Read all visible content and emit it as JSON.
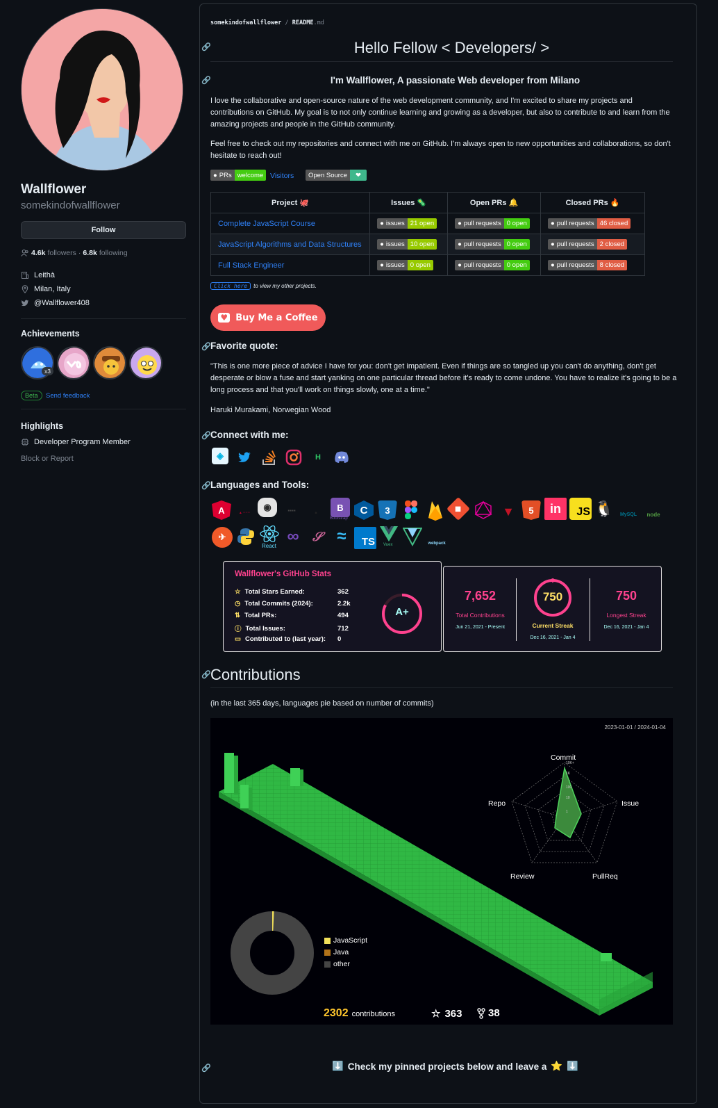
{
  "profile": {
    "name": "Wallflower",
    "login": "somekindofwallflower",
    "follow_label": "Follow",
    "followers_count": "4.6k",
    "followers_label": "followers",
    "separator": "·",
    "following_count": "6.8k",
    "following_label": "following",
    "company": "Leithà",
    "location": "Milan, Italy",
    "twitter": "@Wallflower408",
    "achievements_title": "Achievements",
    "achievement_multiplier": "x3",
    "beta_label": "Beta",
    "send_feedback": "Send feedback",
    "highlights_title": "Highlights",
    "highlight_item": "Developer Program Member",
    "block_report": "Block or Report"
  },
  "readme": {
    "breadcrumb_user": "somekindofwallflower",
    "breadcrumb_sep": "/",
    "breadcrumb_file": "README",
    "breadcrumb_ext": ".md",
    "title": "Hello Fellow < Developers/ >",
    "subtitle": "I'm Wallflower, A passionate Web developer from Milano",
    "para1": "I love the collaborative and open-source nature of the web development community, and I'm excited to share my projects and contributions on GitHub. My goal is to not only continue learning and growing as a developer, but also to contribute to and learn from the amazing projects and people in the GitHub community.",
    "para2": "Feel free to check out my repositories and connect with me on GitHub. I'm always open to new opportunities and collaborations, so don't hesitate to reach out!",
    "badge_prs_left": "PRs",
    "badge_prs_right": "welcome",
    "badge_visitors": "Visitors",
    "badge_open_source": "Open Source",
    "badge_heart": "❤",
    "table_headers": [
      "Project 🐙",
      "Issues 🦠",
      "Open PRs 🔔",
      "Closed PRs 🔥"
    ],
    "projects": [
      {
        "name": "Complete JavaScript Course",
        "issues": "21 open",
        "open_prs": "0 open",
        "closed_prs": "46 closed"
      },
      {
        "name": "JavaScript Algorithms and Data Structures",
        "issues": "10 open",
        "open_prs": "0 open",
        "closed_prs": "2 closed"
      },
      {
        "name": "Full Stack Engineer",
        "issues": "0 open",
        "open_prs": "0 open",
        "closed_prs": "8 closed"
      }
    ],
    "shield_issues_label": "issues",
    "shield_prs_label": "pull requests",
    "click_here": "Click here",
    "click_here_suffix": "to view my other projects.",
    "coffee_label": "Buy Me a Coffee",
    "quote_title": "Favorite quote:",
    "quote_text": "\"This is one more piece of advice I have for you: don't get impatient. Even if things are so tangled up you can't do anything, don't get desperate or blow a fuse and start yanking on one particular thread before it's ready to come undone. You have to realize it's going to be a long process and that you'll work on things slowly, one at a time.\"",
    "quote_author": "Haruki Murakami, Norwegian Wood",
    "connect_title": "Connect with me:",
    "languages_title": "Languages and Tools:",
    "tool_labels": {
      "angular": "A",
      "c": "C",
      "css3": "3",
      "html5": "5",
      "js": "JS",
      "ts": "TS",
      "bootstrap": "B",
      "invision": "in",
      "heroku": "H",
      "react": "React",
      "vuex": "Vuex",
      "bootstrap_caption": "Bootstrap",
      "mysql": "MySQL",
      "node": "node",
      "webpack": "webpack"
    },
    "contributions_title": "Contributions",
    "contributions_note": "(in the last 365 days, languages pie based on number of commits)",
    "pinned_text": "Check my pinned projects below and leave a",
    "pinned_star": "⭐",
    "pinned_arrow": "⬇️"
  },
  "stats_card": {
    "title": "Wallflower's GitHub Stats",
    "rows": [
      {
        "label": "Total Stars Earned:",
        "value": "362"
      },
      {
        "label": "Total Commits (2024):",
        "value": "2.2k"
      },
      {
        "label": "Total PRs:",
        "value": "494"
      },
      {
        "label": "Total Issues:",
        "value": "712"
      },
      {
        "label": "Contributed to (last year):",
        "value": "0"
      }
    ],
    "grade": "A+",
    "accent": "#fe428e",
    "value_color": "#a9fef7"
  },
  "streak_card": {
    "total_value": "7,652",
    "total_label": "Total Contributions",
    "total_range": "Jun 21, 2021 - Present",
    "current_value": "750",
    "current_label": "Current Streak",
    "current_range": "Dec 16, 2021 - Jan 4",
    "longest_value": "750",
    "longest_label": "Longest Streak",
    "longest_range": "Dec 16, 2021 - Jan 4"
  },
  "contrib_graph": {
    "date_range": "2023-01-01 / 2024-01-04",
    "radar_axes": [
      "Commit",
      "Issue",
      "PullReq",
      "Review",
      "Repo"
    ],
    "radar_ticks": [
      "10K+",
      "1K",
      "100",
      "10",
      "1"
    ],
    "languages": [
      "JavaScript",
      "Java",
      "other"
    ],
    "language_colors": [
      "#f1e05a",
      "#b07219",
      "#444444"
    ],
    "contributions_value": "2302",
    "contributions_label": "contributions",
    "stars_value": "363",
    "forks_value": "38"
  }
}
